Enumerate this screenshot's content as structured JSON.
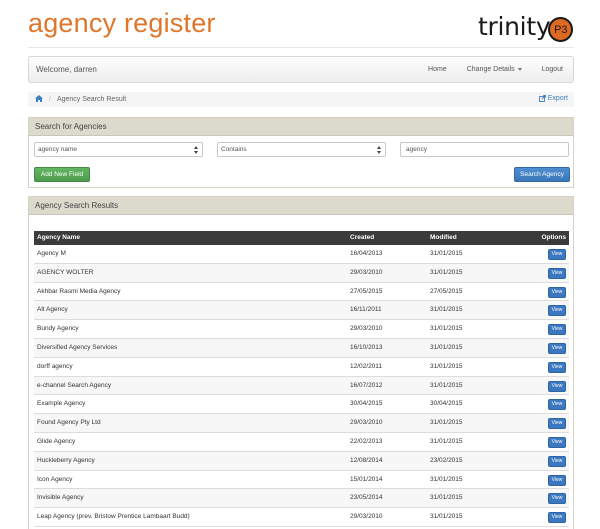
{
  "header": {
    "title": "agency register",
    "logo_text": "trinity",
    "logo_badge": "P3",
    "logo_badge_color": "#de6a22",
    "title_color": "#e0762a"
  },
  "navbar": {
    "welcome": "Welcome, darren",
    "links": [
      "Home",
      "Change Details",
      "Logout"
    ]
  },
  "breadcrumb": {
    "home_icon": "home-icon",
    "current": "Agency Search Result",
    "export_label": "Export"
  },
  "search": {
    "heading": "Search for Agencies",
    "field_select": "agency name",
    "operator_select": "Contains",
    "query_value": "agency",
    "add_field_label": "Add New Field",
    "search_button_label": "Search Agency"
  },
  "results": {
    "heading": "Agency Search Results",
    "columns": [
      "Agency Name",
      "Created",
      "Modified",
      "Options"
    ],
    "view_label": "View",
    "rows": [
      {
        "name": "Agency M",
        "created": "16/04/2013",
        "modified": "31/01/2015"
      },
      {
        "name": "AGENCY WOLTER",
        "created": "29/03/2010",
        "modified": "31/01/2015"
      },
      {
        "name": "Akhbar Rasmi Media Agency",
        "created": "27/05/2015",
        "modified": "27/05/2015"
      },
      {
        "name": "Alt Agency",
        "created": "16/11/2011",
        "modified": "31/01/2015"
      },
      {
        "name": "Bundy Agency",
        "created": "29/03/2010",
        "modified": "31/01/2015"
      },
      {
        "name": "Diversified Agency Services",
        "created": "16/10/2013",
        "modified": "31/01/2015"
      },
      {
        "name": "dorff agency",
        "created": "12/02/2011",
        "modified": "31/01/2015"
      },
      {
        "name": "e-channel Search Agency",
        "created": "16/07/2012",
        "modified": "31/01/2015"
      },
      {
        "name": "Example Agency",
        "created": "30/04/2015",
        "modified": "30/04/2015"
      },
      {
        "name": "Found Agency Pty Ltd",
        "created": "29/03/2010",
        "modified": "31/01/2015"
      },
      {
        "name": "Glide Agency",
        "created": "22/02/2013",
        "modified": "31/01/2015"
      },
      {
        "name": "Huckleberry Agency",
        "created": "12/08/2014",
        "modified": "23/02/2015"
      },
      {
        "name": "Icon Agency",
        "created": "15/01/2014",
        "modified": "31/01/2015"
      },
      {
        "name": "Invisible Agency",
        "created": "23/05/2014",
        "modified": "31/01/2015"
      },
      {
        "name": "Leap Agency (prev. Bristow Prentice Lambaart Budd)",
        "created": "29/03/2010",
        "modified": "31/01/2015"
      }
    ]
  }
}
